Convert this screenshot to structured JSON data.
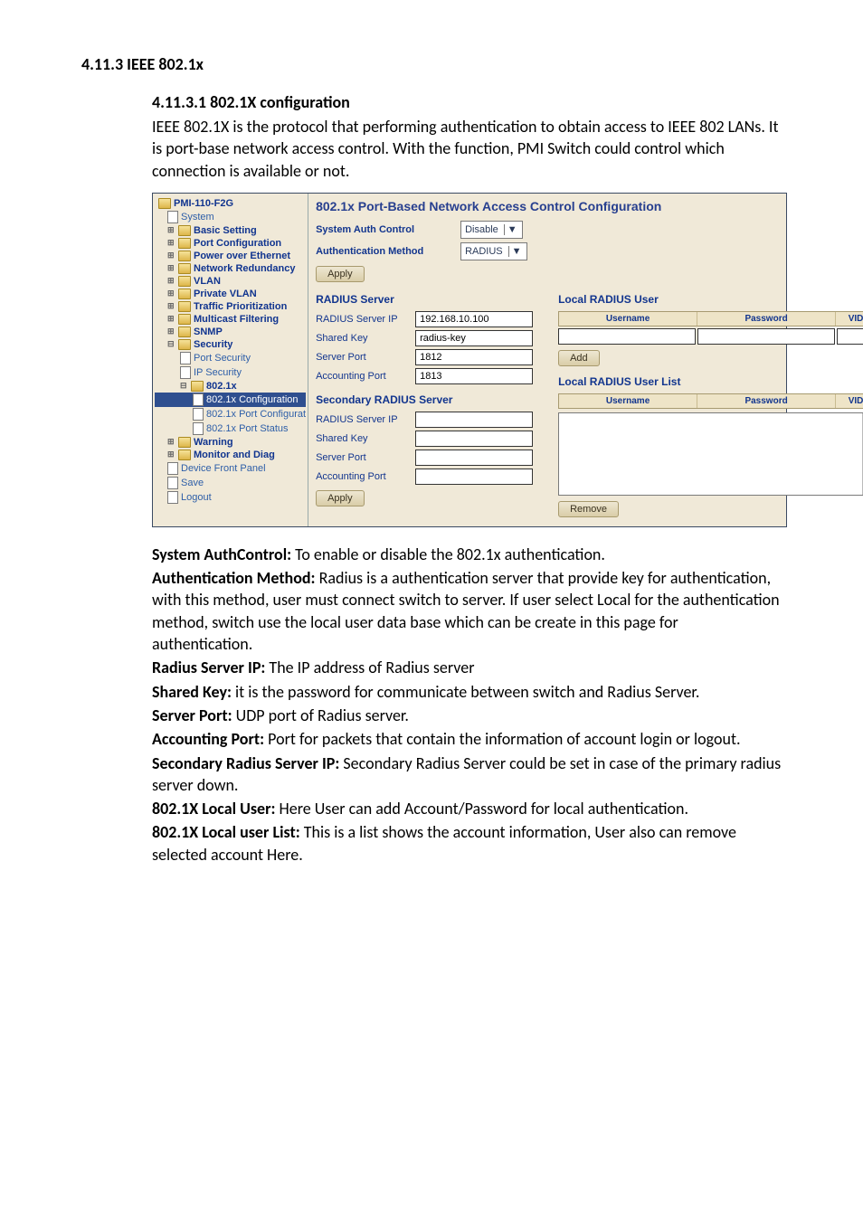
{
  "headings": {
    "sec": "4.11.3  IEEE 802.1x",
    "subsec": "4.11.3.1    802.1X configuration"
  },
  "intro": "IEEE 802.1X is the protocol that performing authentication to obtain access to IEEE 802 LANs. It is port-base network access control. With the function, PMI Switch could control which connection is available or not.",
  "shot": {
    "tree": {
      "root": "PMI-110-F2G",
      "system": "System",
      "items": [
        "Basic Setting",
        "Port Configuration",
        "Power over Ethernet",
        "Network Redundancy",
        "VLAN",
        "Private VLAN",
        "Traffic Prioritization",
        "Multicast Filtering",
        "SNMP"
      ],
      "security": "Security",
      "sec_children": [
        "Port Security",
        "IP Security"
      ],
      "dot1x": "802.1x",
      "dot1x_children": [
        "802.1x Configuration",
        "802.1x Port Configurat",
        "802.1x Port Status"
      ],
      "tail": [
        "Warning",
        "Monitor and Diag"
      ],
      "tail_links": [
        "Device Front Panel",
        "Save",
        "Logout"
      ]
    },
    "panel": {
      "title": "802.1x Port-Based Network Access Control Configuration",
      "sys_auth_label": "System Auth Control",
      "sys_auth_value": "Disable",
      "auth_method_label": "Authentication Method",
      "auth_method_value": "RADIUS",
      "apply": "Apply",
      "radius_server": "RADIUS Server",
      "local_user": "Local RADIUS User",
      "keys": {
        "ip_label": "RADIUS Server IP",
        "ip_value": "192.168.10.100",
        "key_label": "Shared Key",
        "key_value": "radius-key",
        "port_label": "Server Port",
        "port_value": "1812",
        "acct_label": "Accounting Port",
        "acct_value": "1813"
      },
      "cols": {
        "user": "Username",
        "pass": "Password",
        "vid": "VID"
      },
      "add": "Add",
      "secondary": "Secondary RADIUS Server",
      "local_list": "Local RADIUS User List",
      "remove": "Remove"
    }
  },
  "defs": {
    "sys_auth_b": " System AuthControl:",
    "sys_auth_t": " To enable or disable the 802.1x authentication.",
    "auth_b": "Authentication Method:",
    "auth_t": " Radius is a authentication server that provide key for authentication, with this method, user must connect switch to server. If user select Local for the authentication method, switch use the local user data base which can be create in this page for authentication.",
    "rip_b": "Radius Server IP:",
    "rip_t": " The IP address of Radius server",
    "sk_b": "Shared Key:",
    "sk_t": " it is the password for communicate between switch and Radius Server.",
    "sp_b": "Server Port:",
    "sp_t": " UDP port of Radius server.",
    "ap_b": "Accounting Port:",
    "ap_t": " Port for packets that contain the information of account login or logout.",
    "sec_b": "Secondary Radius Server IP:",
    "sec_t": " Secondary Radius Server could be set in case of the primary radius server down.",
    "lu_b": "802.1X Local User:",
    "lu_t": " Here User can add Account/Password for local authentication.",
    "ll_b": "802.1X Local user List:",
    "ll_t": " This is a list shows the account information, User also can remove selected account Here."
  }
}
